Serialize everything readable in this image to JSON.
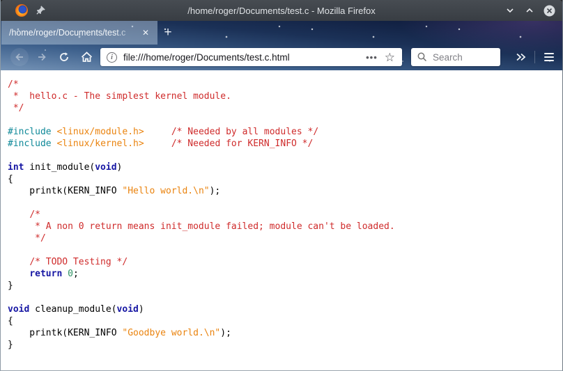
{
  "window": {
    "title": "/home/roger/Documents/test.c - Mozilla Firefox"
  },
  "tabbar": {
    "active_tab_title": "/home/roger/Documents/test.c"
  },
  "navbar": {
    "url": "file:///home/roger/Documents/test.c.html",
    "search_placeholder": "Search"
  },
  "icons": {
    "new_tab": "+",
    "tab_close": "✕",
    "page_actions": "•••",
    "bookmark_star": "☆",
    "info_letter": "i"
  },
  "colors": {
    "c-comment": "#cf2b2b",
    "c-preproc": "#0e8898",
    "c-include": "#ea830e",
    "c-string": "#ea830e",
    "c-keyword": "#1616a3",
    "c-number": "#2e9364",
    "c-plain": "#000000",
    "titlebar-bg": "#3d4248",
    "theme-dark": "#0b1534",
    "theme-light": "#7593b6"
  },
  "code": {
    "language": "c",
    "lines": [
      [
        [
          "c",
          "/*"
        ]
      ],
      [
        [
          "c",
          " *  hello.c - The simplest kernel module."
        ]
      ],
      [
        [
          "c",
          " */"
        ]
      ],
      [],
      [
        [
          "p",
          "#include"
        ],
        [
          "t",
          " "
        ],
        [
          "i",
          "<linux/module.h>"
        ],
        [
          "t",
          "     "
        ],
        [
          "c",
          "/* Needed by all modules */"
        ]
      ],
      [
        [
          "p",
          "#include"
        ],
        [
          "t",
          " "
        ],
        [
          "i",
          "<linux/kernel.h>"
        ],
        [
          "t",
          "     "
        ],
        [
          "c",
          "/* Needed for KERN_INFO */"
        ]
      ],
      [],
      [
        [
          "k",
          "int"
        ],
        [
          "t",
          " init_module("
        ],
        [
          "k",
          "void"
        ],
        [
          "t",
          ")"
        ]
      ],
      [
        [
          "t",
          "{"
        ]
      ],
      [
        [
          "t",
          "    printk(KERN_INFO "
        ],
        [
          "s",
          "\"Hello world.\\n\""
        ],
        [
          "t",
          ");"
        ]
      ],
      [],
      [
        [
          "t",
          "    "
        ],
        [
          "c",
          "/*"
        ]
      ],
      [
        [
          "c",
          "     * A non 0 return means init_module failed; module can't be loaded."
        ]
      ],
      [
        [
          "c",
          "     */"
        ]
      ],
      [],
      [
        [
          "t",
          "    "
        ],
        [
          "c",
          "/* TODO Testing */"
        ]
      ],
      [
        [
          "t",
          "    "
        ],
        [
          "k",
          "return"
        ],
        [
          "t",
          " "
        ],
        [
          "n",
          "0"
        ],
        [
          "t",
          ";"
        ]
      ],
      [
        [
          "t",
          "}"
        ]
      ],
      [],
      [
        [
          "k",
          "void"
        ],
        [
          "t",
          " cleanup_module("
        ],
        [
          "k",
          "void"
        ],
        [
          "t",
          ")"
        ]
      ],
      [
        [
          "t",
          "{"
        ]
      ],
      [
        [
          "t",
          "    printk(KERN_INFO "
        ],
        [
          "s",
          "\"Goodbye world.\\n\""
        ],
        [
          "t",
          ");"
        ]
      ],
      [
        [
          "t",
          "}"
        ]
      ]
    ]
  }
}
